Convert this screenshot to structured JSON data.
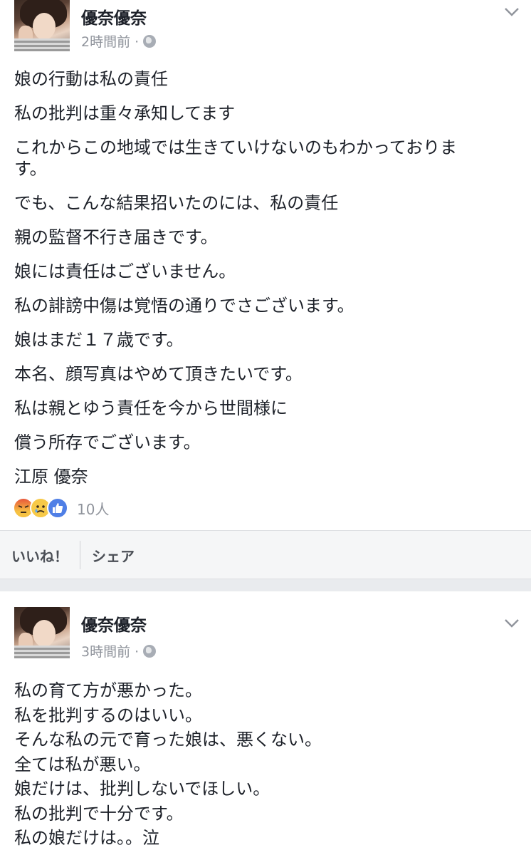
{
  "posts": [
    {
      "author": "優奈優奈",
      "time": "2時間前 ·",
      "lines": [
        "娘の行動は私の責任",
        "私の批判は重々承知してます",
        "これからこの地域では生きていけないのもわかっておりま",
        "す。",
        "でも、こんな結果招いたのには、私の責任",
        "親の監督不行き届きです。",
        "娘には責任はございません。",
        "私の誹謗中傷は覚悟の通りでさございます。",
        "娘はまだ１７歳です。",
        "本名、顔写真はやめて頂きたいです。",
        "私は親とゆう責任を今から世間様に",
        "償う所存でございます。",
        "江原 優奈"
      ],
      "reactions": {
        "types": [
          "angry-reaction-icon",
          "sad-reaction-icon",
          "like-reaction-icon"
        ],
        "count": "10人"
      },
      "actions": {
        "like": "いいね！",
        "share": "シェア"
      }
    },
    {
      "author": "優奈優奈",
      "time": "3時間前 ·",
      "lines": [
        "私の育て方が悪かった。",
        "私を批判するのはいい。",
        "そんな私の元で育った娘は、悪くない。",
        "全ては私が悪い。",
        "娘だけは、批判しないでほしい。",
        "私の批判で十分です。",
        "私の娘だけは。。泣"
      ]
    }
  ],
  "colors": {
    "text": "#1d2129",
    "meta": "#90949c",
    "action_bar": "#f5f6f7",
    "separator": "#e9ebee",
    "like_blue": "#4f7fe6"
  }
}
